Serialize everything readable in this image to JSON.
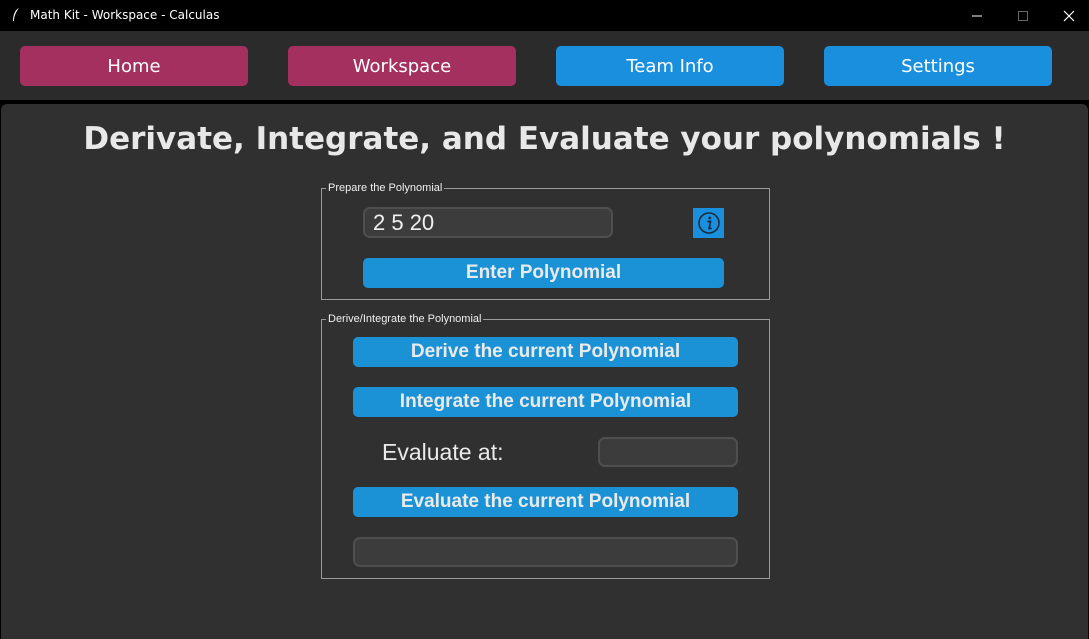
{
  "window": {
    "title": "Math Kit - Workspace - Calculas",
    "app_icon": "feather-icon",
    "controls": [
      "minimize-icon",
      "maximize-icon",
      "close-icon"
    ]
  },
  "nav": {
    "home": "Home",
    "workspace": "Workspace",
    "team_info": "Team Info",
    "settings": "Settings"
  },
  "main": {
    "heading": "Derivate, Integrate, and Evaluate your polynomials !",
    "prepare_group": {
      "label": "Prepare the Polynomial",
      "polynomial_value": "2 5 20",
      "info_icon": "info-icon",
      "enter_button": "Enter Polynomial"
    },
    "derive_group": {
      "label": "Derive/Integrate the Polynomial",
      "derive_button": "Derive the current Polynomial",
      "integrate_button": "Integrate the current Polynomial",
      "evaluate_label": "Evaluate at:",
      "evaluate_value": "",
      "evaluate_button": "Evaluate the current Polynomial",
      "result_value": ""
    }
  },
  "colors": {
    "active_nav": "#a3305e",
    "inactive_nav": "#1a8fde",
    "action_button": "#1b92d6",
    "panel_background": "#303030"
  }
}
